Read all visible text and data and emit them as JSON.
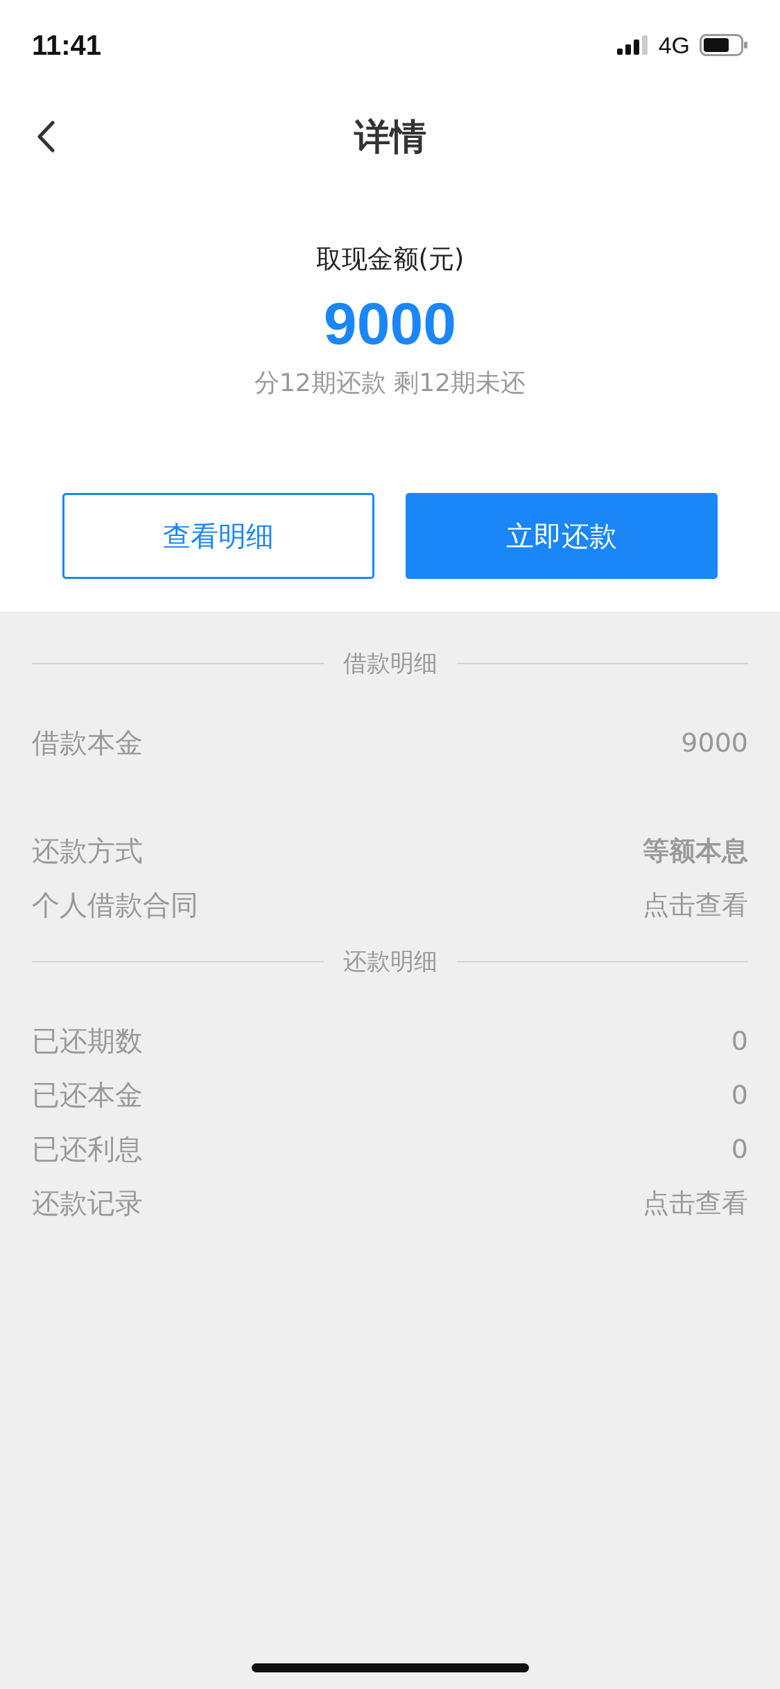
{
  "status_bar": {
    "time": "11:41",
    "network": "4G"
  },
  "nav": {
    "title": "详情"
  },
  "summary": {
    "label": "取现金额(元)",
    "amount": "9000",
    "subtitle": "分12期还款 剩12期未还"
  },
  "buttons": [
    {
      "label": "查看明细",
      "kind": "outline"
    },
    {
      "label": "立即还款",
      "kind": "primary"
    }
  ],
  "sections": [
    {
      "title": "借款明细",
      "groups": [
        [
          {
            "label": "借款本金",
            "value": "9000",
            "kind": "plain"
          }
        ],
        [
          {
            "label": "还款方式",
            "value": "等额本息",
            "kind": "strong"
          },
          {
            "label": "个人借款合同",
            "value": "点击查看",
            "kind": "link"
          }
        ]
      ]
    },
    {
      "title": "还款明细",
      "groups": [
        [
          {
            "label": "已还期数",
            "value": "0",
            "kind": "plain"
          },
          {
            "label": "已还本金",
            "value": "0",
            "kind": "plain"
          },
          {
            "label": "已还利息",
            "value": "0",
            "kind": "plain"
          },
          {
            "label": "还款记录",
            "value": "点击查看",
            "kind": "link"
          }
        ]
      ]
    }
  ]
}
